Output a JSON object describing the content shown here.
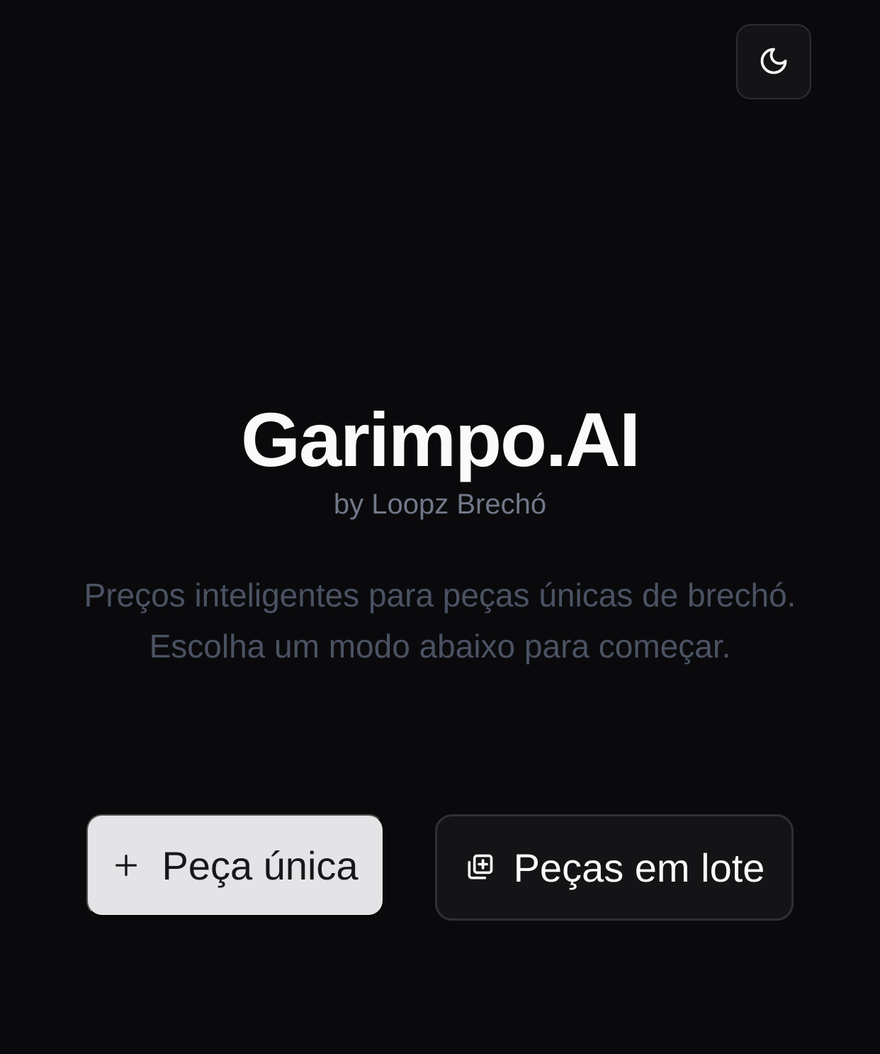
{
  "header": {
    "theme_toggle_icon": "moon-icon"
  },
  "hero": {
    "title": "Garimpo.AI",
    "byline": "by Loopz Brechó",
    "tagline": "Preços inteligentes para peças únicas de brechó. Escolha um modo abaixo para começar."
  },
  "actions": {
    "single": {
      "label": "Peça única",
      "icon": "plus-icon"
    },
    "batch": {
      "label": "Peças em lote",
      "icon": "copy-plus-icon"
    }
  },
  "colors": {
    "background": "#0a0a0c",
    "title": "#fafafa",
    "byline": "#717888",
    "tagline": "#4a5263",
    "primary_button_bg": "#e4e4e7",
    "secondary_button_bg": "#141417"
  }
}
